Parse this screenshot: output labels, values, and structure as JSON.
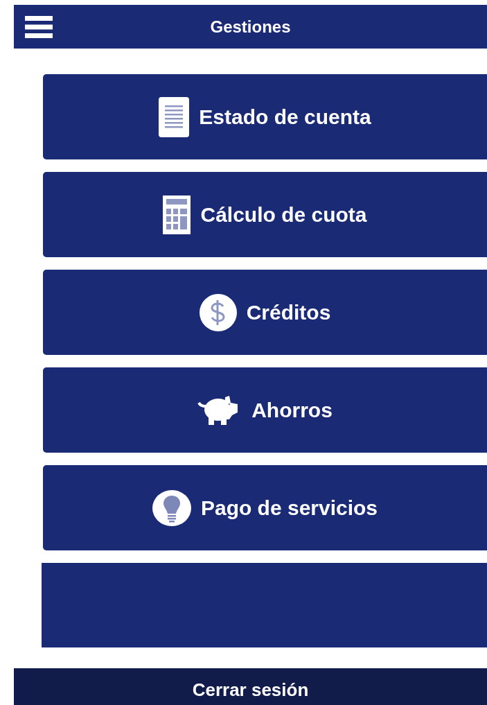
{
  "header": {
    "title": "Gestiones"
  },
  "menu_items": [
    {
      "kind": "statement",
      "label": "Estado de cuenta"
    },
    {
      "kind": "calculator",
      "label": "Cálculo de cuota"
    },
    {
      "kind": "credit",
      "label": "Créditos"
    },
    {
      "kind": "savings",
      "label": "Ahorros"
    },
    {
      "kind": "services",
      "label": "Pago de servicios"
    }
  ],
  "footer": {
    "label": "Cerrar sesión"
  }
}
